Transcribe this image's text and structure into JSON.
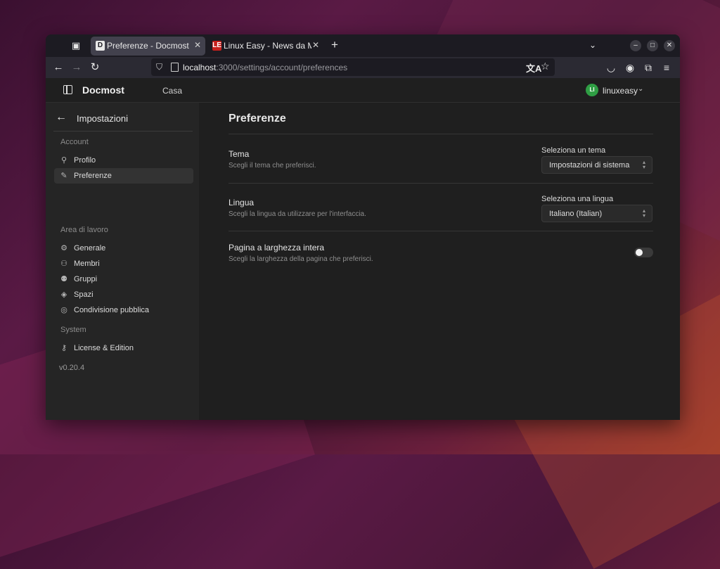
{
  "browser": {
    "tabs": [
      {
        "favicon": "D",
        "title": "Preferenze - Docmost",
        "active": true
      },
      {
        "favicon": "LE",
        "title": "Linux Easy - News da Mondo Linux",
        "active": false
      }
    ],
    "url_host": "localhost",
    "url_path": ":3000/settings/account/preferences"
  },
  "header": {
    "brand": "Docmost",
    "home_link": "Casa",
    "avatar_initials": "LI",
    "avatar_color": "#2f9e44",
    "username": "linuxeasy"
  },
  "sidebar": {
    "title": "Impostazioni",
    "sections": [
      {
        "label": "Account",
        "items": [
          {
            "label": "Profilo",
            "icon": "user-icon"
          },
          {
            "label": "Preferenze",
            "icon": "brush-icon",
            "active": true
          }
        ]
      },
      {
        "label": "Area di lavoro",
        "items": [
          {
            "label": "Generale",
            "icon": "settings-icon"
          },
          {
            "label": "Membri",
            "icon": "users-icon"
          },
          {
            "label": "Gruppi",
            "icon": "users-group-icon"
          },
          {
            "label": "Spazi",
            "icon": "spaces-icon"
          },
          {
            "label": "Condivisione pubblica",
            "icon": "world-icon"
          }
        ]
      },
      {
        "label": "System",
        "items": [
          {
            "label": "License & Edition",
            "icon": "key-icon"
          }
        ]
      }
    ],
    "version": "v0.20.4"
  },
  "main": {
    "title": "Preferenze",
    "theme": {
      "title": "Tema",
      "description": "Scegli il tema che preferisci.",
      "select_label": "Seleziona un tema",
      "value": "Impostazioni di sistema"
    },
    "language": {
      "title": "Lingua",
      "description": "Scegli la lingua da utilizzare per l'interfaccia.",
      "select_label": "Seleziona una lingua",
      "value": "Italiano (Italian)"
    },
    "full_width": {
      "title": "Pagina a larghezza intera",
      "description": "Scegli la larghezza della pagina che preferisci.",
      "enabled": false
    }
  }
}
